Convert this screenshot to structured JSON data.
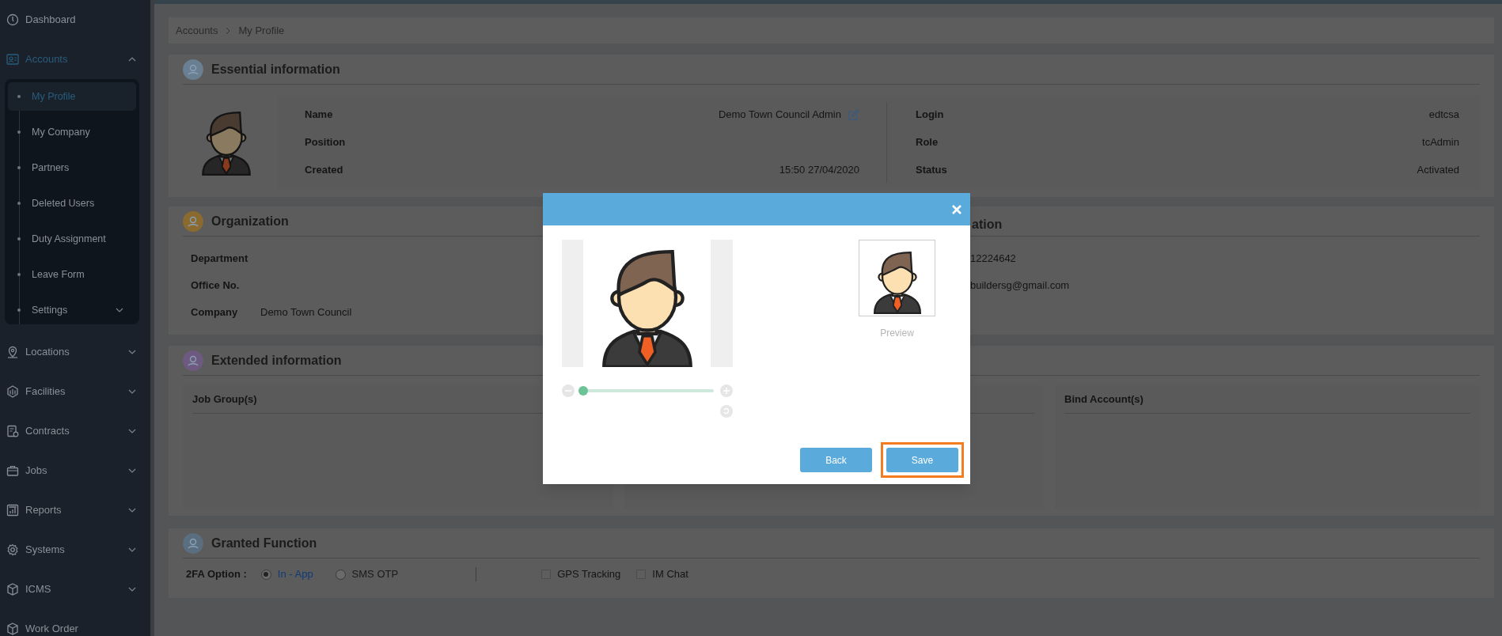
{
  "sidebar": {
    "items": [
      {
        "label": "Dashboard",
        "selected": false
      },
      {
        "label": "Accounts",
        "selected": true,
        "expanded": true,
        "children": [
          {
            "label": "My Profile",
            "selected": true
          },
          {
            "label": "My Company",
            "selected": false
          },
          {
            "label": "Partners",
            "selected": false
          },
          {
            "label": "Deleted Users",
            "selected": false
          },
          {
            "label": "Duty Assignment",
            "selected": false
          },
          {
            "label": "Leave Form",
            "selected": false
          },
          {
            "label": "Settings",
            "selected": false,
            "expanded": false
          }
        ]
      },
      {
        "label": "Locations",
        "selected": false,
        "expanded": false
      },
      {
        "label": "Facilities",
        "selected": false,
        "expanded": false
      },
      {
        "label": "Contracts",
        "selected": false,
        "expanded": false
      },
      {
        "label": "Jobs",
        "selected": false,
        "expanded": false
      },
      {
        "label": "Reports",
        "selected": false,
        "expanded": false
      },
      {
        "label": "Systems",
        "selected": false,
        "expanded": false
      },
      {
        "label": "ICMS",
        "selected": false,
        "expanded": false
      },
      {
        "label": "Work Order",
        "selected": false
      }
    ]
  },
  "breadcrumb": [
    "Accounts",
    "My Profile"
  ],
  "essential": {
    "title": "Essential information",
    "left_fields": [
      {
        "label": "Name",
        "value": "Demo Town Council Admin",
        "editable": true
      },
      {
        "label": "Position"
      },
      {
        "label": "Created",
        "value": "15:50 27/04/2020"
      }
    ],
    "right_fields": [
      {
        "label": "Login",
        "value": "edtcsa"
      },
      {
        "label": "Role",
        "value": "tcAdmin"
      },
      {
        "label": "Status",
        "value": "Activated"
      }
    ]
  },
  "organization": {
    "title": "Organization",
    "fields": [
      {
        "label": "Department"
      },
      {
        "label": "Office No."
      },
      {
        "label": "Company",
        "value": "Demo Town Council"
      }
    ],
    "right_panel": {
      "title": "ation",
      "values": [
        "12224642",
        "buildersg@gmail.com"
      ]
    }
  },
  "extended": {
    "title": "Extended information",
    "panels": [
      {
        "title": "Job Group(s)"
      },
      {
        "title": "Bind Account(s)"
      }
    ]
  },
  "granted": {
    "title": "Granted Function",
    "option_label": "2FA Option :",
    "radios": [
      {
        "label": "In - App",
        "selected": true
      },
      {
        "label": "SMS OTP",
        "selected": false
      }
    ],
    "checkboxes": [
      {
        "label": "GPS Tracking",
        "checked": false
      },
      {
        "label": "IM Chat",
        "checked": false
      }
    ]
  },
  "dialog": {
    "zoom": {
      "level": 0.02
    },
    "preview_label": "Preview",
    "buttons": [
      {
        "label": "Back",
        "highlighted": false
      },
      {
        "label": "Save",
        "highlighted": true
      }
    ]
  }
}
